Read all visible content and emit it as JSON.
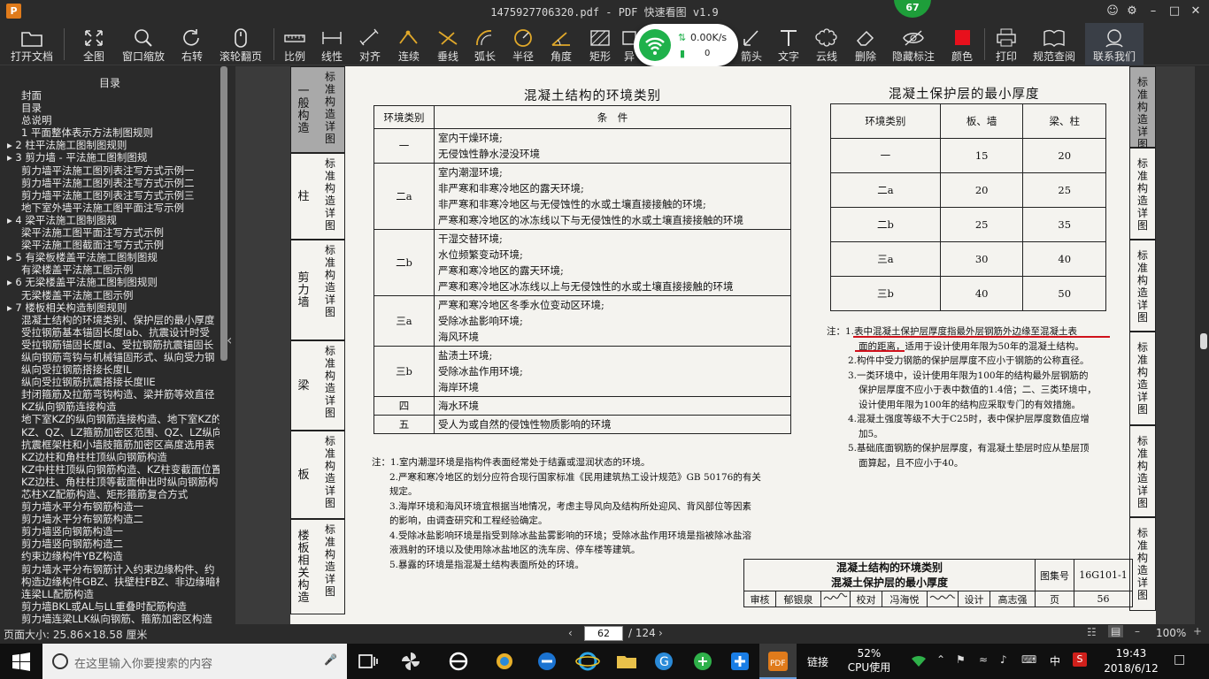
{
  "window": {
    "logo": "P",
    "title": "1475927706320.pdf - PDF 快速看图 v1.9",
    "badge": "67"
  },
  "toolbar": {
    "buttons": [
      "打开文档",
      "全图",
      "窗口缩放",
      "右转",
      "滚轮翻页",
      "比例",
      "线性",
      "对齐",
      "连续",
      "垂线",
      "弧长",
      "半径",
      "角度",
      "矩形",
      "异",
      "箭头",
      "文字",
      "云线",
      "删除",
      "隐藏标注",
      "颜色",
      "打印",
      "规范查阅",
      "联系我们"
    ]
  },
  "net": {
    "speed": "0.00K/s",
    "count": "0"
  },
  "sidebar": {
    "title": "目录",
    "items": [
      "封面",
      "目录",
      "总说明",
      "1 平面整体表示方法制图规则",
      "▸ 2 柱平法施工图制图规则",
      "▸ 3 剪力墙 - 平法施工图制图规",
      "剪力墙平法施工图列表注写方式示例一",
      "剪力墙平法施工图列表注写方式示例二",
      "剪力墙平法施工图列表注写方式示例三",
      "地下室外墙平法施工图平面注写示例",
      "▸ 4 梁平法施工图制图规",
      "梁平法施工图平面注写方式示例",
      "梁平法施工图截面注写方式示例",
      "▸ 5 有梁板楼盖平法施工图制图规",
      "有梁楼盖平法施工图示例",
      "▸ 6 无梁楼盖平法施工图制图规则",
      "无梁楼盖平法施工图示例",
      "▸ 7 楼板相关构造制图规则",
      "混凝土结构的环境类别、保护层的最小厚度",
      "受拉钢筋基本锚固长度lab、抗震设计时受",
      "受拉钢筋锚固长度la、受拉钢筋抗震锚固长",
      "纵向钢筋弯钩与机械锚固形式、纵向受力钢",
      "纵向受拉钢筋搭接长度lL",
      "纵向受拉钢筋抗震搭接长度llE",
      "封闭箍筋及拉筋弯钩构造、梁并筋等效直径",
      "KZ纵向钢筋连接构造",
      "地下室KZ的纵向钢筋连接构造、地下室KZ的",
      "KZ、QZ、LZ箍筋加密区范围、QZ、LZ纵向钢",
      "抗震框架柱和小墙肢箍筋加密区高度选用表",
      "KZ边柱和角柱柱顶纵向钢筋构造",
      "KZ中柱柱顶纵向钢筋构造、KZ柱变截面位置",
      "KZ边柱、角柱柱顶等截面伸出时纵向钢筋构",
      "芯柱XZ配筋构造、矩形箍筋复合方式",
      "剪力墙水平分布钢筋构造一",
      "剪力墙水平分布钢筋构造二",
      "剪力墙竖向钢筋构造一",
      "剪力墙竖向钢筋构造二",
      "约束边缘构件YBZ构造",
      "剪力墙水平分布钢筋计入约束边缘构件、约",
      "构造边缘构件GBZ、扶壁柱FBZ、非边缘暗柱",
      "连梁LL配筋构造",
      "剪力墙BKL或AL与LL重叠时配筋构造",
      "剪力墙连梁LLK纵向钢筋、箍筋加密区构造"
    ]
  },
  "page": {
    "left_tabs": [
      {
        "text": "一般构造",
        "sub": "标准构造详图"
      },
      {
        "text": "柱",
        "sub": "标准构造详图"
      },
      {
        "text": "剪力墙",
        "sub": "标准构造详图"
      },
      {
        "text": "梁",
        "sub": "标准构造详图"
      },
      {
        "text": "板",
        "sub": "标准构造详图"
      },
      {
        "text": "楼板相关构造",
        "sub": "标准构造详图"
      }
    ],
    "env_title": "混凝土结构的环境类别",
    "env_headers": [
      "环境类别",
      "条　件"
    ],
    "env_rows": [
      {
        "cls": "一",
        "conds": [
          "室内干燥环境;",
          "无侵蚀性静水浸没环境"
        ]
      },
      {
        "cls": "二a",
        "conds": [
          "室内潮湿环境;",
          "非严寒和非寒冷地区的露天环境;",
          "非严寒和非寒冷地区与无侵蚀性的水或土壤直接接触的环境;",
          "严寒和寒冷地区的冰冻线以下与无侵蚀性的水或土壤直接接触的环境"
        ]
      },
      {
        "cls": "二b",
        "conds": [
          "干湿交替环境;",
          "水位频繁变动环境;",
          "严寒和寒冷地区的露天环境;",
          "严寒和寒冷地区冰冻线以上与无侵蚀性的水或土壤直接接触的环境"
        ]
      },
      {
        "cls": "三a",
        "conds": [
          "严寒和寒冷地区冬季水位变动区环境;",
          "受除冰盐影响环境;",
          "海风环境"
        ]
      },
      {
        "cls": "三b",
        "conds": [
          "盐渍土环境;",
          "受除冰盐作用环境;",
          "海岸环境"
        ]
      },
      {
        "cls": "四",
        "conds": [
          "海水环境"
        ]
      },
      {
        "cls": "五",
        "conds": [
          "受人为或自然的侵蚀性物质影响的环境"
        ]
      }
    ],
    "env_notes": [
      "注：1.室内潮湿环境是指构件表面经常处于结露或湿润状态的环境。",
      "2.严寒和寒冷地区的划分应符合现行国家标准《民用建筑热工设计规范》GB 50176的有关",
      "规定。",
      "3.海岸环境和海风环境宜根据当地情况，考虑主导风向及结构所处迎风、背风部位等因素",
      "的影响，由调查研究和工程经验确定。",
      "4.受除冰盐影响环境是指受到除冰盐盐雾影响的环境；受除冰盐作用环境是指被除冰盐溶",
      "液溅射的环境以及使用除冰盐地区的洗车房、停车楼等建筑。",
      "5.暴露的环境是指混凝土结构表面所处的环境。"
    ],
    "cov_title": "混凝土保护层的最小厚度",
    "cov_headers": [
      "环境类别",
      "板、墙",
      "梁、柱"
    ],
    "cov_rows": [
      [
        "一",
        "15",
        "20"
      ],
      [
        "二a",
        "20",
        "25"
      ],
      [
        "二b",
        "25",
        "35"
      ],
      [
        "三a",
        "30",
        "40"
      ],
      [
        "三b",
        "40",
        "50"
      ]
    ],
    "cov_notes": [
      "注：1.表中混凝土保护层厚度指最外层钢筋外边缘至混凝土表",
      "面的距离，适用于设计使用年限为50年的混凝土结构。",
      "2.构件中受力钢筋的保护层厚度不应小于钢筋的公称直径。",
      "3.一类环境中，设计使用年限为100年的结构最外层钢筋的",
      "保护层厚度不应小于表中数值的1.4倍；二、三类环境中，",
      "设计使用年限为100年的结构应采取专门的有效措施。",
      "4.混凝土强度等级不大于C25时，表中保护层厚度数值应增",
      "加5。",
      "5.基础底面钢筋的保护层厚度，有混凝土垫层时应从垫层顶",
      "面算起，且不应小于40。"
    ],
    "title_block": {
      "line1": "混凝土结构的环境类别",
      "line2": "混凝土保护层的最小厚度",
      "atlas_label": "图集号",
      "atlas_no": "16G101-1",
      "page_label": "页",
      "page_no": "56",
      "row": [
        "审核",
        "郁银泉",
        "校对",
        "冯海悦",
        "设计",
        "高志强"
      ]
    },
    "right_tabs": [
      "标准构造详图",
      "标准构造详图",
      "标准构造详图",
      "标准构造详图",
      "标准构造详图",
      "标准构造详图"
    ]
  },
  "status": {
    "page_size": "页面大小: 25.86×18.58 厘米",
    "current_page": "62",
    "total_pages": "/ 124",
    "zoom": "100%"
  },
  "taskbar": {
    "search_placeholder": "在这里输入你要搜索的内容",
    "network_label": "链接",
    "cpu_percent": "52%",
    "cpu_label": "CPU使用",
    "ime": "中",
    "time": "19:43",
    "date": "2018/6/12"
  },
  "colors": {
    "accent_red": "#d0111b",
    "app_orange": "#e07b1b",
    "wifi_green": "#1fb14b"
  }
}
